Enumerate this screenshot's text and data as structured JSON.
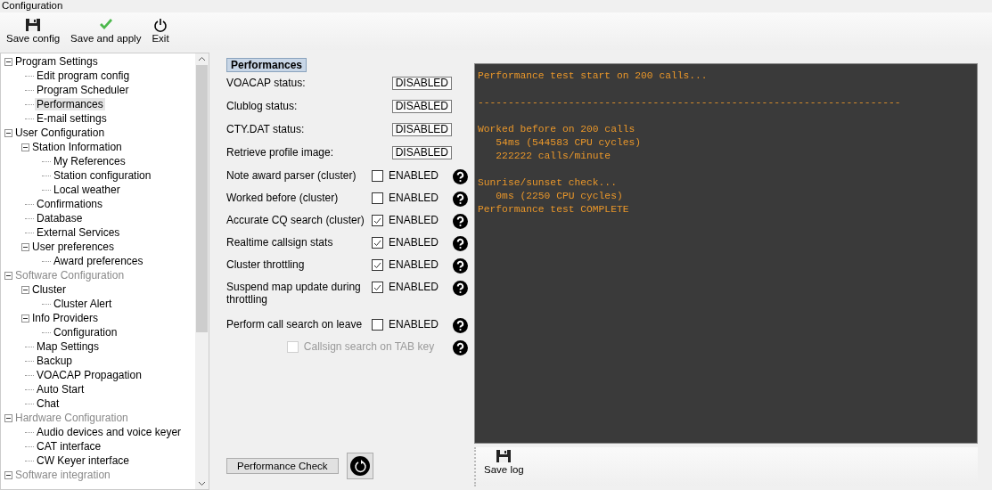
{
  "window": {
    "title": "Configuration"
  },
  "toolbar": [
    {
      "kind": "save",
      "label": "Save config"
    },
    {
      "kind": "check",
      "label": "Save and apply"
    },
    {
      "kind": "power",
      "label": "Exit"
    }
  ],
  "tree": [
    {
      "label": "Program Settings",
      "expanded": true,
      "disabled": false,
      "selected": false,
      "children": [
        {
          "label": "Edit program config",
          "selected": false
        },
        {
          "label": "Program Scheduler",
          "selected": false
        },
        {
          "label": "Performances",
          "selected": true
        },
        {
          "label": "E-mail settings",
          "selected": false
        }
      ]
    },
    {
      "label": "User Configuration",
      "expanded": true,
      "disabled": false,
      "selected": false,
      "children": [
        {
          "label": "Station Information",
          "expanded": true,
          "selected": false,
          "children": [
            {
              "label": "My References",
              "selected": false
            },
            {
              "label": "Station configuration",
              "selected": false
            },
            {
              "label": "Local weather",
              "selected": false
            }
          ]
        },
        {
          "label": "Confirmations",
          "selected": false
        },
        {
          "label": "Database",
          "selected": false
        },
        {
          "label": "External Services",
          "selected": false
        },
        {
          "label": "User preferences",
          "expanded": true,
          "selected": false,
          "children": [
            {
              "label": "Award preferences",
              "selected": false
            }
          ]
        }
      ]
    },
    {
      "label": "Software Configuration",
      "expanded": true,
      "disabled": true,
      "selected": false,
      "children": [
        {
          "label": "Cluster",
          "expanded": true,
          "selected": false,
          "children": [
            {
              "label": "Cluster Alert",
              "selected": false
            }
          ]
        },
        {
          "label": "Info Providers",
          "expanded": true,
          "selected": false,
          "children": [
            {
              "label": "Configuration",
              "selected": false
            }
          ]
        },
        {
          "label": "Map Settings",
          "selected": false
        },
        {
          "label": "Backup",
          "selected": false
        },
        {
          "label": "VOACAP Propagation",
          "selected": false
        },
        {
          "label": "Auto Start",
          "selected": false
        },
        {
          "label": "Chat",
          "selected": false
        }
      ]
    },
    {
      "label": "Hardware Configuration",
      "expanded": true,
      "disabled": true,
      "selected": false,
      "children": [
        {
          "label": "Audio devices and voice keyer",
          "selected": false
        },
        {
          "label": "CAT interface",
          "selected": false
        },
        {
          "label": "CW Keyer interface",
          "selected": false
        }
      ]
    },
    {
      "label": "Software integration",
      "expanded": true,
      "disabled": true,
      "selected": false
    }
  ],
  "panel": {
    "heading": "Performances",
    "rows": [
      {
        "kind": "status",
        "label": "VOACAP status:",
        "value": "DISABLED"
      },
      {
        "kind": "status",
        "label": "Clublog status:",
        "value": "DISABLED"
      },
      {
        "kind": "status",
        "label": "CTY.DAT status:",
        "value": "DISABLED"
      },
      {
        "kind": "status",
        "label": "Retrieve profile image:",
        "value": "DISABLED"
      },
      {
        "kind": "toggle",
        "label": "Note award parser (cluster)",
        "checked": false,
        "disabled": false,
        "text": "ENABLED"
      },
      {
        "kind": "toggle",
        "label": "Worked before (cluster)",
        "checked": false,
        "disabled": false,
        "text": "ENABLED"
      },
      {
        "kind": "toggle",
        "label": "Accurate CQ search (cluster)",
        "checked": true,
        "disabled": false,
        "text": "ENABLED"
      },
      {
        "kind": "toggle",
        "label": "Realtime callsign stats",
        "checked": true,
        "disabled": false,
        "text": "ENABLED"
      },
      {
        "kind": "toggle",
        "label": "Cluster throttling",
        "checked": true,
        "disabled": false,
        "text": "ENABLED"
      },
      {
        "kind": "toggle",
        "label": "Suspend map update during throttling",
        "checked": true,
        "disabled": false,
        "text": "ENABLED"
      },
      {
        "kind": "toggle",
        "label": "Perform call search on leave",
        "checked": false,
        "disabled": false,
        "text": "ENABLED"
      },
      {
        "kind": "toggle",
        "checked": false,
        "disabled": true,
        "text": "Callsign search on TAB key"
      }
    ],
    "check_button": "Performance Check"
  },
  "log": {
    "blocks": [
      [
        "Performance test start on 200 calls..."
      ],
      [
        "----------------------------------------------------------------------"
      ],
      [
        "Worked before on 200 calls",
        "   54ms (544583 CPU cycles)",
        "   222222 calls/minute"
      ],
      [
        "Sunrise/sunset check...",
        "   0ms (2250 CPU cycles)",
        "Performance test COMPLETE"
      ]
    ],
    "save_button": "Save log"
  }
}
